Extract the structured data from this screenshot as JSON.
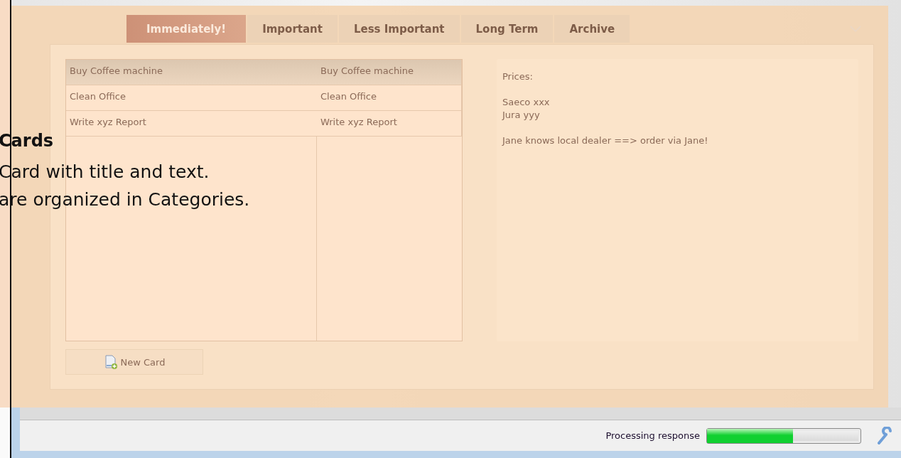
{
  "slide": {
    "heading": "Cards",
    "lines": [
      "Card with title and text.",
      "are organized in Categories."
    ]
  },
  "tabs": [
    {
      "label": "Immediately!",
      "selected": true
    },
    {
      "label": "Important",
      "selected": false
    },
    {
      "label": "Less Important",
      "selected": false
    },
    {
      "label": "Long Term",
      "selected": false
    },
    {
      "label": "Archive",
      "selected": false
    }
  ],
  "cards_table": {
    "rows": [
      {
        "cells": [
          "Buy Coffee machine",
          "Buy Coffee machine"
        ],
        "selected": true
      },
      {
        "cells": [
          "Clean Office",
          "Clean Office"
        ],
        "selected": false
      },
      {
        "cells": [
          "Write xyz Report",
          "Write xyz Report"
        ],
        "selected": false
      }
    ]
  },
  "note": {
    "paragraphs": [
      [
        "Prices:"
      ],
      [
        "Saeco xxx",
        "Jura yyy"
      ],
      [
        "Jane knows local dealer ==> order via Jane!"
      ]
    ]
  },
  "new_card_button": {
    "label": "New Card"
  },
  "status_bar": {
    "text": "Processing response",
    "progress": {
      "level": 0.56
    }
  }
}
